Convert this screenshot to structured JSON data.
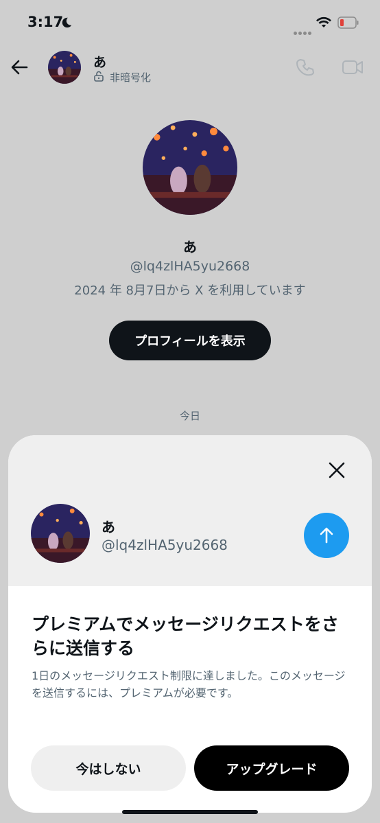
{
  "status_bar": {
    "time": "3:17"
  },
  "header": {
    "name": "あ",
    "encryption": "非暗号化",
    "icons": [
      "back-arrow-icon",
      "phone-icon",
      "video-icon",
      "lock-open-icon"
    ]
  },
  "profile": {
    "name": "あ",
    "handle": "@lq4zlHA5yu2668",
    "joined": "2024 年 8月7日から X を利用しています",
    "view_profile_label": "プロフィールを表示"
  },
  "day_separator": "今日",
  "sheet": {
    "name": "あ",
    "handle": "@lq4zlHA5yu2668",
    "title": "プレミアムでメッセージリクエストをさらに送信する",
    "description": "1日のメッセージリクエスト制限に達しました。このメッセージを送信するには、プレミアムが必要です。",
    "not_now_label": "今はしない",
    "upgrade_label": "アップグレード"
  },
  "colors": {
    "accent": "#1d9bf0",
    "dark": "#0f1419",
    "secondary_text": "#536471"
  }
}
